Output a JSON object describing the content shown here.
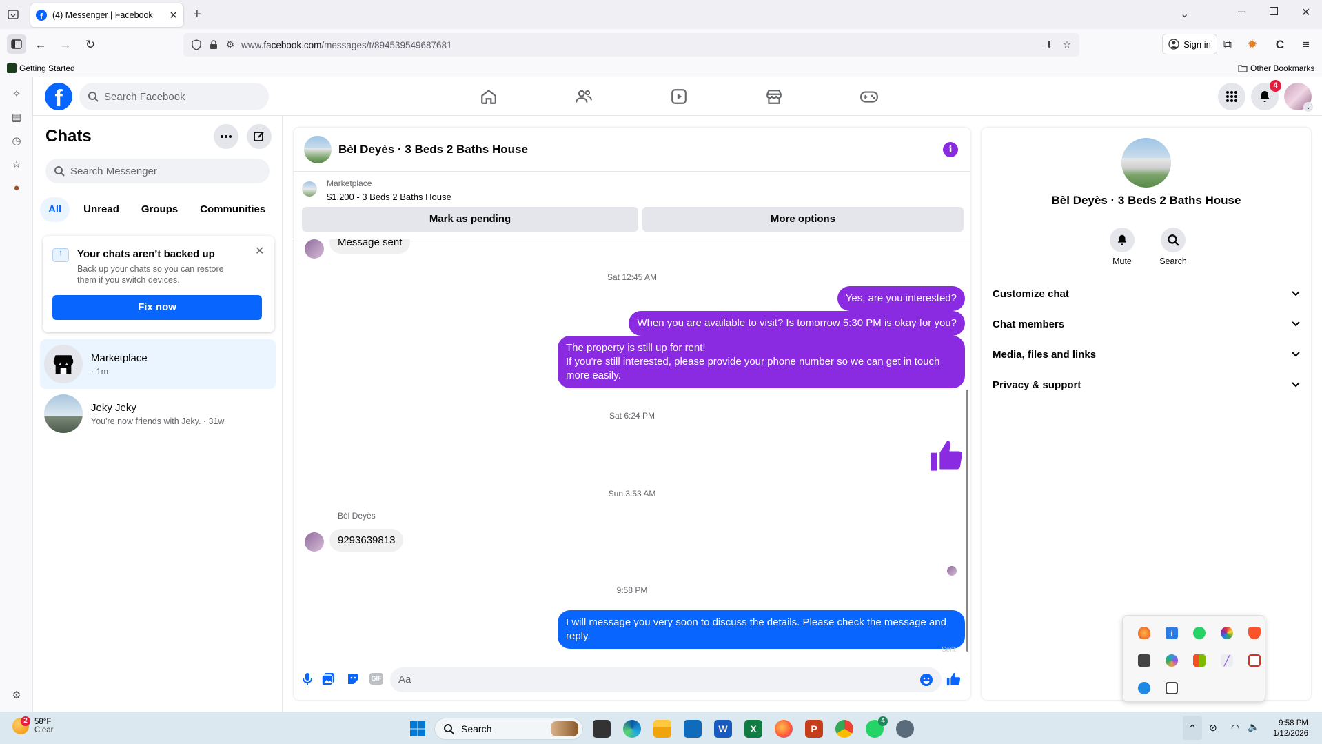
{
  "browser": {
    "tab_title": "(4) Messenger | Facebook",
    "url_prefix": "www.",
    "url_domain": "facebook.com",
    "url_path": "/messages/t/894539549687681",
    "sign_in": "Sign in",
    "bookmark_getting_started": "Getting Started",
    "bookmark_other": "Other Bookmarks"
  },
  "fb": {
    "search_placeholder": "Search Facebook",
    "notification_count": "4"
  },
  "chats": {
    "title": "Chats",
    "search_placeholder": "Search Messenger",
    "filters": [
      "All",
      "Unread",
      "Groups",
      "Communities"
    ],
    "backup_title": "Your chats aren’t backed up",
    "backup_text": "Back up your chats so you can restore them if you switch devices.",
    "fix_now": "Fix now",
    "list": [
      {
        "name": "Marketplace",
        "preview": "· 1m"
      },
      {
        "name": "Jeky Jeky",
        "preview": "You're now friends with Jeky. · 31w"
      }
    ]
  },
  "conversation": {
    "title": "Bèl Deyès · 3 Beds 2 Baths House",
    "marketplace_label": "Marketplace",
    "listing": "$1,200 - 3 Beds 2 Baths House",
    "mark_pending": "Mark as pending",
    "more_options": "More options",
    "msg_sent": "Message sent",
    "ts1": "Sat 12:45 AM",
    "out1": "Yes, are you interested?",
    "out2": "When you are available to visit? Is tomorrow 5:30 PM is okay for you?",
    "out3_line1": "The property is still up for rent!",
    "out3_line2": "If you're still interested, please provide your phone number so we can get in touch more easily.",
    "ts2": "Sat 6:24 PM",
    "ts3": "Sun 3:53 AM",
    "sender_name": "Bèl Deyès",
    "in_phone": "9293639813",
    "ts4": "9:58 PM",
    "out4": "I will message you very soon to discuss the details. Please check the message and reply.",
    "sent_status": "Sent",
    "input_placeholder": "Aa"
  },
  "info": {
    "title": "Bèl Deyès · 3 Beds 2 Baths House",
    "mute": "Mute",
    "search": "Search",
    "rows": [
      "Customize chat",
      "Chat members",
      "Media, files and links",
      "Privacy & support"
    ]
  },
  "taskbar": {
    "temp": "58°F",
    "weather": "Clear",
    "weather_badge": "2",
    "search": "Search",
    "time": "9:58 PM",
    "date": "1/12/2026",
    "whatsapp_badge": "4"
  },
  "colors": {
    "fb_blue": "#0866ff",
    "purple_bubble": "#8a2be2",
    "badge_red": "#e41e3f"
  }
}
